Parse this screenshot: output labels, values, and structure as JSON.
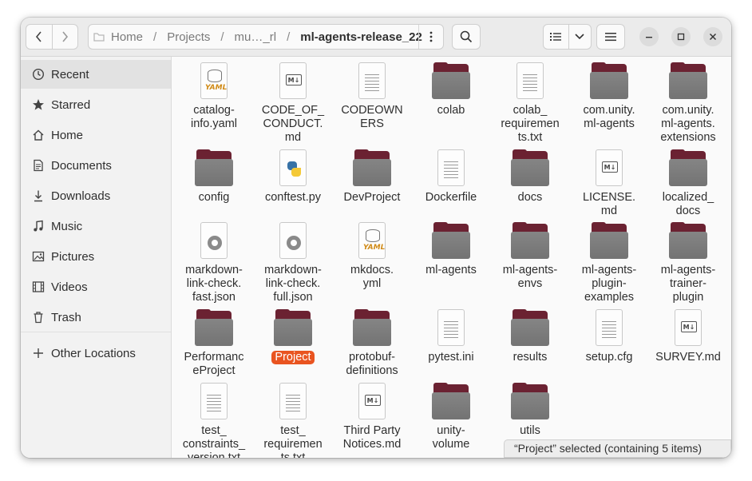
{
  "header": {
    "breadcrumbs": [
      "Home",
      "Projects",
      "mu…_rl",
      "ml-agents-release_22"
    ]
  },
  "sidebar": {
    "items": [
      {
        "label": "Recent",
        "icon": "clock-icon"
      },
      {
        "label": "Starred",
        "icon": "star-icon"
      },
      {
        "label": "Home",
        "icon": "home-icon"
      },
      {
        "label": "Documents",
        "icon": "document-icon"
      },
      {
        "label": "Downloads",
        "icon": "download-icon"
      },
      {
        "label": "Music",
        "icon": "music-icon"
      },
      {
        "label": "Pictures",
        "icon": "picture-icon"
      },
      {
        "label": "Videos",
        "icon": "video-icon"
      },
      {
        "label": "Trash",
        "icon": "trash-icon"
      },
      {
        "label": "Other Locations",
        "icon": "plus-icon"
      }
    ]
  },
  "files": [
    {
      "label": "catalog-\ninfo.yaml",
      "type": "yaml"
    },
    {
      "label": "CODE_OF_\nCONDUCT.\nmd",
      "type": "md"
    },
    {
      "label": "CODEOWN\nERS",
      "type": "text"
    },
    {
      "label": "colab",
      "type": "folder"
    },
    {
      "label": "colab_\nrequiremen\nts.txt",
      "type": "text"
    },
    {
      "label": "com.unity.\nml-agents",
      "type": "folder"
    },
    {
      "label": "com.unity.\nml-agents.\nextensions",
      "type": "folder"
    },
    {
      "label": "config",
      "type": "folder"
    },
    {
      "label": "conftest.py",
      "type": "python"
    },
    {
      "label": "DevProject",
      "type": "folder"
    },
    {
      "label": "Dockerfile",
      "type": "text"
    },
    {
      "label": "docs",
      "type": "folder"
    },
    {
      "label": "LICENSE.\nmd",
      "type": "md"
    },
    {
      "label": "localized_\ndocs",
      "type": "folder"
    },
    {
      "label": "markdown-\nlink-check.\nfast.json",
      "type": "json"
    },
    {
      "label": "markdown-\nlink-check.\nfull.json",
      "type": "json"
    },
    {
      "label": "mkdocs.\nyml",
      "type": "yaml"
    },
    {
      "label": "ml-agents",
      "type": "folder"
    },
    {
      "label": "ml-agents-\nenvs",
      "type": "folder"
    },
    {
      "label": "ml-agents-\nplugin-\nexamples",
      "type": "folder"
    },
    {
      "label": "ml-agents-\ntrainer-\nplugin",
      "type": "folder"
    },
    {
      "label": "Performanc\neProject",
      "type": "folder"
    },
    {
      "label": "Project",
      "type": "folder",
      "selected": true
    },
    {
      "label": "protobuf-\ndefinitions",
      "type": "folder"
    },
    {
      "label": "pytest.ini",
      "type": "text"
    },
    {
      "label": "results",
      "type": "folder"
    },
    {
      "label": "setup.cfg",
      "type": "text"
    },
    {
      "label": "SURVEY.md",
      "type": "md"
    },
    {
      "label": "test_\nconstraints_\nversion.txt",
      "type": "text"
    },
    {
      "label": "test_\nrequiremen\nts.txt",
      "type": "text"
    },
    {
      "label": "Third Party\nNotices.md",
      "type": "md"
    },
    {
      "label": "unity-\nvolume",
      "type": "folder"
    },
    {
      "label": "utils",
      "type": "folder"
    }
  ],
  "status": {
    "text": "“Project” selected  (containing 5 items)"
  },
  "colors": {
    "folder": "#6b2232",
    "selection": "#e95420"
  }
}
